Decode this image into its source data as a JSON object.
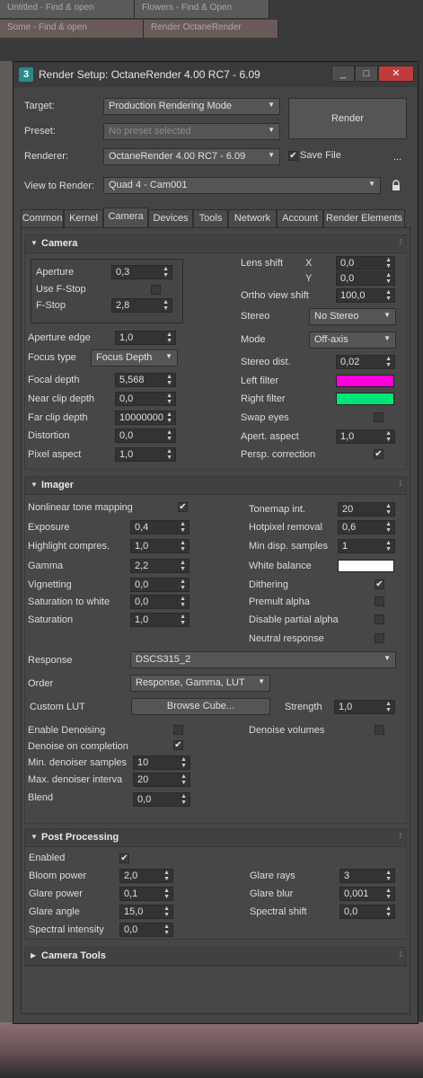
{
  "background": {
    "tabs": [
      "Untitled - Find & open",
      "Flowers - Find & Open",
      "Some - Find & open",
      "Render OctaneRender"
    ]
  },
  "window": {
    "title": "Render Setup: OctaneRender 4.00 RC7 - 6.09",
    "minimize": "_",
    "maximize": "□",
    "close": "✕"
  },
  "header": {
    "target_label": "Target:",
    "target_value": "Production Rendering Mode",
    "preset_label": "Preset:",
    "preset_value": "No preset selected",
    "renderer_label": "Renderer:",
    "renderer_value": "OctaneRender 4.00 RC7 - 6.09",
    "save_file_label": "Save File",
    "save_file_checked": "✔",
    "render_button": "Render",
    "more_button": "...",
    "view_label": "View to Render:",
    "view_value": "Quad 4 - Cam001",
    "lock_icon": "lock-icon"
  },
  "tabs": [
    "Common",
    "Kernel",
    "Camera",
    "Devices",
    "Tools",
    "Network",
    "Account",
    "Render Elements"
  ],
  "active_tab": "Camera",
  "camera": {
    "title": "Camera",
    "aperture_label": "Aperture",
    "aperture": "0,3",
    "use_fstop_label": "Use F-Stop",
    "fstop_label": "F-Stop",
    "fstop": "2,8",
    "aperture_edge_label": "Aperture edge",
    "aperture_edge": "1,0",
    "focus_type_label": "Focus type",
    "focus_type": "Focus Depth",
    "focal_depth_label": "Focal depth",
    "focal_depth": "5,568",
    "near_clip_label": "Near clip depth",
    "near_clip": "0,0",
    "far_clip_label": "Far clip depth",
    "far_clip": "10000000",
    "distortion_label": "Distortion",
    "distortion": "0,0",
    "pixel_aspect_label": "Pixel aspect",
    "pixel_aspect": "1,0",
    "lens_shift_label": "Lens shift",
    "x_label": "X",
    "y_label": "Y",
    "lens_shift_x": "0,0",
    "lens_shift_y": "0,0",
    "ortho_label": "Ortho view shift",
    "ortho": "100,0",
    "stereo_label": "Stereo",
    "stereo": "No Stereo",
    "mode_label": "Mode",
    "mode": "Off-axis",
    "stereo_dist_label": "Stereo dist.",
    "stereo_dist": "0,02",
    "left_filter_label": "Left filter",
    "left_filter_color": "#ff00dd",
    "right_filter_label": "Right filter",
    "right_filter_color": "#00e676",
    "swap_eyes_label": "Swap eyes",
    "apert_aspect_label": "Apert. aspect",
    "apert_aspect": "1,0",
    "persp_label": "Persp. correction",
    "persp_checked": "✔"
  },
  "imager": {
    "title": "Imager",
    "nonlinear_label": "Nonlinear tone mapping",
    "nonlinear_checked": "✔",
    "exposure_label": "Exposure",
    "exposure": "0,4",
    "highlight_label": "Highlight compres.",
    "highlight": "1,0",
    "gamma_label": "Gamma",
    "gamma": "2,2",
    "vignetting_label": "Vignetting",
    "vignetting": "0,0",
    "sat_white_label": "Saturation to white",
    "sat_white": "0,0",
    "saturation_label": "Saturation",
    "saturation": "1,0",
    "tonemap_label": "Tonemap int.",
    "tonemap": "20",
    "hotpixel_label": "Hotpixel removal",
    "hotpixel": "0,6",
    "min_disp_label": "Min disp. samples",
    "min_disp": "1",
    "white_balance_label": "White balance",
    "white_balance_color": "#ffffff",
    "dithering_label": "Dithering",
    "dithering_checked": "✔",
    "premult_label": "Premult alpha",
    "disable_partial_label": "Disable partial alpha",
    "neutral_label": "Neutral response",
    "response_label": "Response",
    "response": "DSCS315_2",
    "order_label": "Order",
    "order": "Response, Gamma, LUT",
    "custom_lut_label": "Custom LUT",
    "browse_button": "Browse Cube...",
    "strength_label": "Strength",
    "strength": "1,0",
    "enable_denoise_label": "Enable Denoising",
    "denoise_volumes_label": "Denoise volumes",
    "denoise_completion_label": "Denoise on completion",
    "denoise_completion_checked": "✔",
    "min_denoise_label": "Min. denoiser samples",
    "min_denoise": "10",
    "max_denoise_label": "Max. denoiser interva",
    "max_denoise": "20",
    "blend_label": "Blend",
    "blend": "0,0"
  },
  "post": {
    "title": "Post Processing",
    "enabled_label": "Enabled",
    "enabled_checked": "✔",
    "bloom_label": "Bloom power",
    "bloom": "2,0",
    "glare_power_label": "Glare power",
    "glare_power": "0,1",
    "glare_angle_label": "Glare angle",
    "glare_angle": "15,0",
    "spectral_int_label": "Spectral intensity",
    "spectral_int": "0,0",
    "glare_rays_label": "Glare rays",
    "glare_rays": "3",
    "glare_blur_label": "Glare blur",
    "glare_blur": "0,001",
    "spectral_shift_label": "Spectral shift",
    "spectral_shift": "0,0"
  },
  "camera_tools": {
    "title": "Camera Tools"
  },
  "glyphs": {
    "arrow": "▼",
    "spin": "▲\n▼",
    "tri_open": "▼",
    "tri_closed": "▶",
    "grip": "⁞⁞"
  }
}
